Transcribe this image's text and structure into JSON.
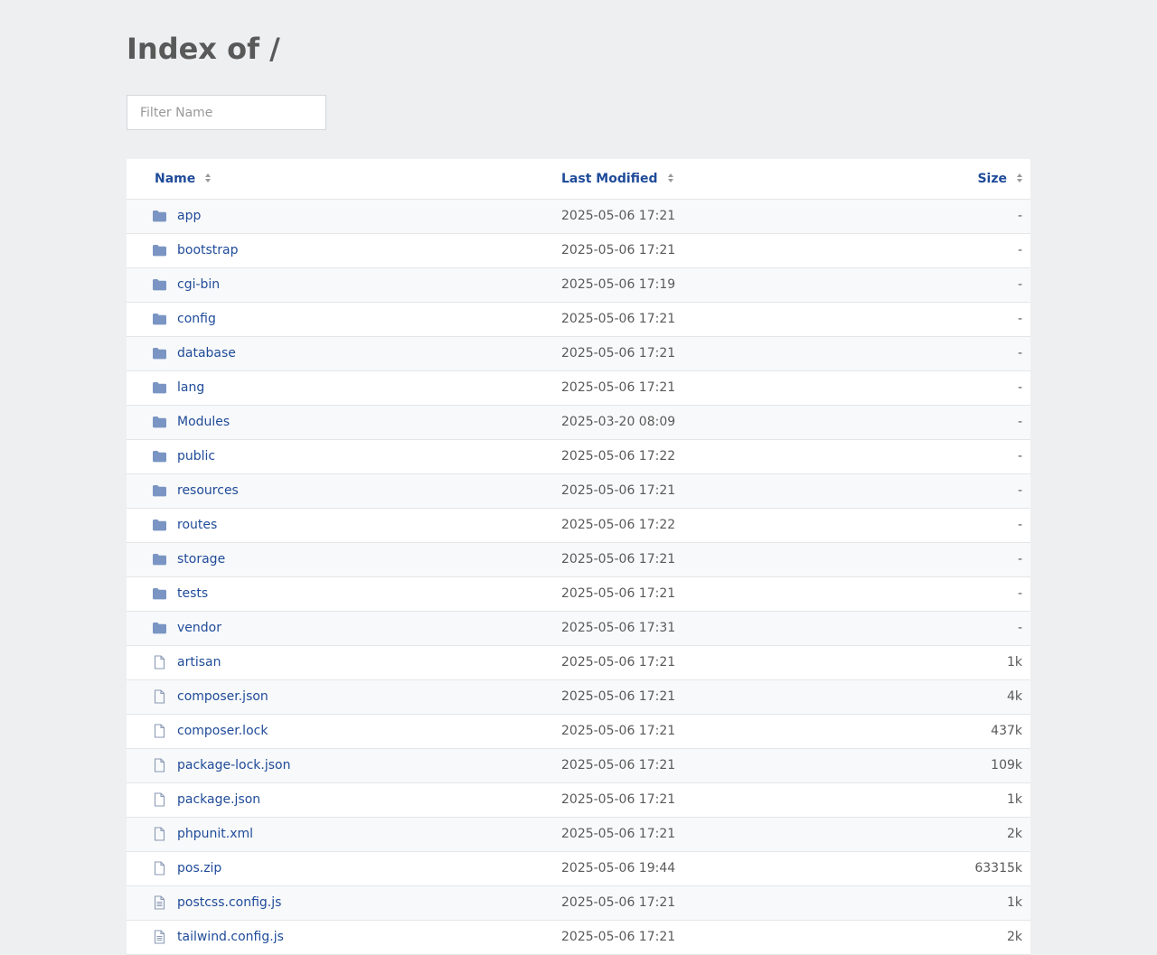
{
  "page": {
    "title": "Index of /"
  },
  "filter": {
    "placeholder": "Filter Name",
    "value": ""
  },
  "table": {
    "headers": {
      "name": "Name",
      "modified": "Last Modified",
      "size": "Size"
    },
    "rows": [
      {
        "type": "folder",
        "icon": "folder-icon",
        "name": "app",
        "modified": "2025-05-06 17:21",
        "size": "-"
      },
      {
        "type": "folder",
        "icon": "folder-icon",
        "name": "bootstrap",
        "modified": "2025-05-06 17:21",
        "size": "-"
      },
      {
        "type": "folder",
        "icon": "folder-icon",
        "name": "cgi-bin",
        "modified": "2025-05-06 17:19",
        "size": "-"
      },
      {
        "type": "folder",
        "icon": "folder-icon",
        "name": "config",
        "modified": "2025-05-06 17:21",
        "size": "-"
      },
      {
        "type": "folder",
        "icon": "folder-icon",
        "name": "database",
        "modified": "2025-05-06 17:21",
        "size": "-"
      },
      {
        "type": "folder",
        "icon": "folder-icon",
        "name": "lang",
        "modified": "2025-05-06 17:21",
        "size": "-"
      },
      {
        "type": "folder",
        "icon": "folder-icon",
        "name": "Modules",
        "modified": "2025-03-20 08:09",
        "size": "-"
      },
      {
        "type": "folder",
        "icon": "folder-icon",
        "name": "public",
        "modified": "2025-05-06 17:22",
        "size": "-"
      },
      {
        "type": "folder",
        "icon": "folder-icon",
        "name": "resources",
        "modified": "2025-05-06 17:21",
        "size": "-"
      },
      {
        "type": "folder",
        "icon": "folder-icon",
        "name": "routes",
        "modified": "2025-05-06 17:22",
        "size": "-"
      },
      {
        "type": "folder",
        "icon": "folder-icon",
        "name": "storage",
        "modified": "2025-05-06 17:21",
        "size": "-"
      },
      {
        "type": "folder",
        "icon": "folder-icon",
        "name": "tests",
        "modified": "2025-05-06 17:21",
        "size": "-"
      },
      {
        "type": "folder",
        "icon": "folder-icon",
        "name": "vendor",
        "modified": "2025-05-06 17:31",
        "size": "-"
      },
      {
        "type": "file",
        "icon": "file-icon",
        "name": "artisan",
        "modified": "2025-05-06 17:21",
        "size": "1k"
      },
      {
        "type": "file",
        "icon": "file-icon",
        "name": "composer.json",
        "modified": "2025-05-06 17:21",
        "size": "4k"
      },
      {
        "type": "file",
        "icon": "file-icon",
        "name": "composer.lock",
        "modified": "2025-05-06 17:21",
        "size": "437k"
      },
      {
        "type": "file",
        "icon": "file-icon",
        "name": "package-lock.json",
        "modified": "2025-05-06 17:21",
        "size": "109k"
      },
      {
        "type": "file",
        "icon": "file-icon",
        "name": "package.json",
        "modified": "2025-05-06 17:21",
        "size": "1k"
      },
      {
        "type": "file",
        "icon": "file-icon",
        "name": "phpunit.xml",
        "modified": "2025-05-06 17:21",
        "size": "2k"
      },
      {
        "type": "file",
        "icon": "file-icon",
        "name": "pos.zip",
        "modified": "2025-05-06 19:44",
        "size": "63315k"
      },
      {
        "type": "text",
        "icon": "text-file-icon",
        "name": "postcss.config.js",
        "modified": "2025-05-06 17:21",
        "size": "1k"
      },
      {
        "type": "text",
        "icon": "text-file-icon",
        "name": "tailwind.config.js",
        "modified": "2025-05-06 17:21",
        "size": "2k"
      }
    ]
  },
  "colors": {
    "background": "#eeeff1",
    "link": "#1f4b99",
    "text": "#595959",
    "folder_icon": "#7a95c4"
  }
}
